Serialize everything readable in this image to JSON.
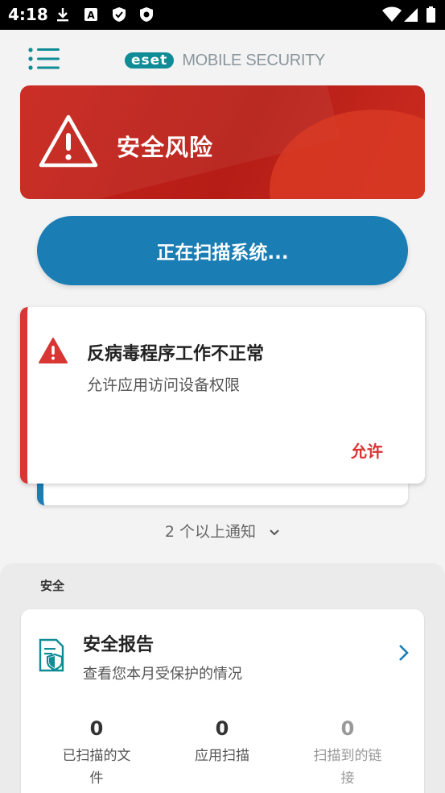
{
  "status_bar": {
    "time": "4:18",
    "icons": [
      "download-icon",
      "a-icon",
      "shield-icon",
      "shield-eset-icon"
    ],
    "right_icons": [
      "wifi-icon",
      "signal-icon",
      "battery-icon"
    ]
  },
  "header": {
    "logo": "eset",
    "product": "MOBILE SECURITY",
    "menu_icon": "menu-icon"
  },
  "risk_banner": {
    "title": "安全风险",
    "color": "#c8221a"
  },
  "scan_button": {
    "label": "正在扫描系统..."
  },
  "notification": {
    "title": "反病毒程序工作不正常",
    "subtitle": "允许应用访问设备权限",
    "action": "允许",
    "accent": "#d83533"
  },
  "more_notifications": {
    "label": "2 个以上通知"
  },
  "security_section": {
    "title": "安全",
    "report": {
      "title": "安全报告",
      "subtitle": "查看您本月受保护的情况",
      "stats": [
        {
          "value": "0",
          "label": "已扫描的文件"
        },
        {
          "value": "0",
          "label": "应用扫描"
        },
        {
          "value": "0",
          "label": "扫描到的链接"
        }
      ]
    }
  }
}
